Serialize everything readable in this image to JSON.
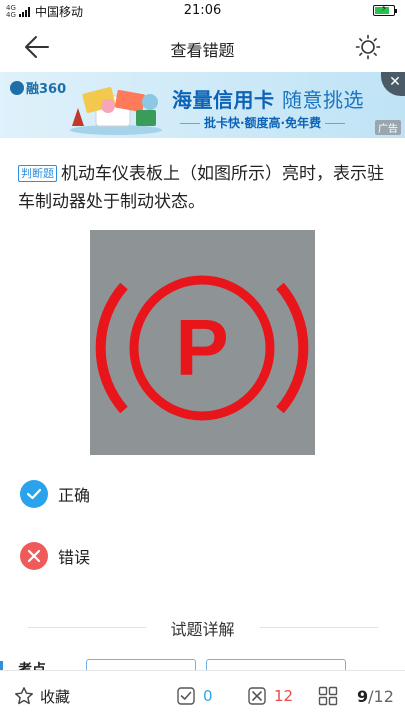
{
  "status_bar": {
    "network": "4G 4G",
    "carrier": "中国移动",
    "time": "21:06",
    "battery_level": 0.8
  },
  "nav": {
    "title": "查看错题",
    "back_icon": "arrow-left-icon",
    "theme_icon": "sun-icon"
  },
  "ad": {
    "logo": "融360",
    "headline_bold": "海量信用卡",
    "headline_light": "随意挑选",
    "subline": "批卡快·额度高·免年费",
    "tag": "广告",
    "close_icon": "close-icon"
  },
  "question": {
    "type_tag": "判断题",
    "text": "机动车仪表板上（如图所示）亮时，表示驻车制动器处于制动状态。",
    "image_symbol": "P"
  },
  "options": [
    {
      "label": "正确",
      "icon": "check-icon",
      "color": "#2aa3ec"
    },
    {
      "label": "错误",
      "icon": "cross-icon",
      "color": "#ef5b5b"
    }
  ],
  "detail": {
    "title": "试题详解",
    "partial_label": "考点"
  },
  "bottom_bar": {
    "favorite_label": "收藏",
    "correct_count": "0",
    "wrong_count": "12",
    "current_page": "9",
    "total_pages": "/12"
  },
  "colors": {
    "accent": "#2aa3ec",
    "wrong": "#ef5b5b",
    "symbol_red": "#e8151b",
    "image_bg": "#8e9396"
  }
}
